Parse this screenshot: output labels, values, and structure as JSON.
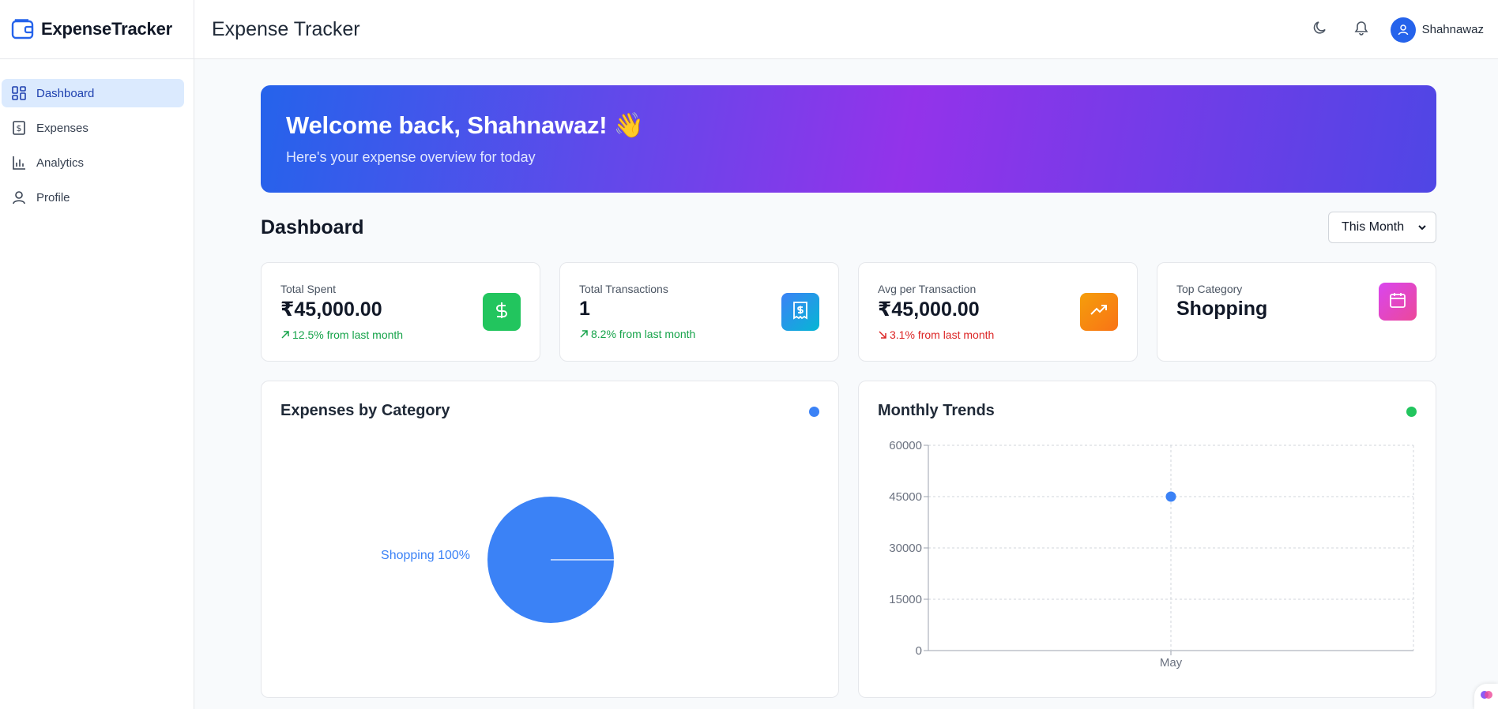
{
  "app": {
    "brand": "ExpenseTracker",
    "header_title": "Expense Tracker",
    "user_name": "Shahnawaz"
  },
  "sidebar": {
    "items": [
      {
        "label": "Dashboard",
        "icon": "dashboard-icon",
        "active": true
      },
      {
        "label": "Expenses",
        "icon": "receipt-icon",
        "active": false
      },
      {
        "label": "Analytics",
        "icon": "bar-chart-icon",
        "active": false
      },
      {
        "label": "Profile",
        "icon": "user-icon",
        "active": false
      }
    ]
  },
  "banner": {
    "greeting": "Welcome back, Shahnawaz! 👋",
    "subtitle": "Here's your expense overview for today"
  },
  "dashboard": {
    "title": "Dashboard",
    "period_selected": "This Month"
  },
  "stats": [
    {
      "label": "Total Spent",
      "value": "₹45,000.00",
      "change": "12.5% from last month",
      "trend": "up",
      "icon": "dollar-icon",
      "color": "#22c55e"
    },
    {
      "label": "Total Transactions",
      "value": "1",
      "change": "8.2% from last month",
      "trend": "up",
      "icon": "receipt-icon",
      "color": "#3b82f6"
    },
    {
      "label": "Avg per Transaction",
      "value": "₹45,000.00",
      "change": "3.1% from last month",
      "trend": "down",
      "icon": "trending-up-icon",
      "color": "#f59e0b"
    },
    {
      "label": "Top Category",
      "value": "Shopping",
      "change": "",
      "trend": "",
      "icon": "calendar-icon",
      "color": "#d946ef"
    }
  ],
  "chart_data": [
    {
      "type": "pie",
      "title": "Expenses by Category",
      "slices": [
        {
          "label": "Shopping",
          "value": 100,
          "display": "Shopping 100%"
        }
      ],
      "color": "#3b82f6",
      "legend_dot_color": "#3b82f6"
    },
    {
      "type": "scatter",
      "title": "Monthly Trends",
      "categories": [
        "May"
      ],
      "values": [
        45000
      ],
      "yticks": [
        "0",
        "15000",
        "30000",
        "45000",
        "60000"
      ],
      "ylim": [
        0,
        60000
      ],
      "grid": true,
      "point_color": "#3b82f6",
      "legend_dot_color": "#22c55e"
    }
  ],
  "colors": {
    "accent": "#2563eb",
    "active_nav_bg": "#dbeafe",
    "banner_gradient": [
      "#2563eb",
      "#9333ea",
      "#4f46e5"
    ]
  }
}
